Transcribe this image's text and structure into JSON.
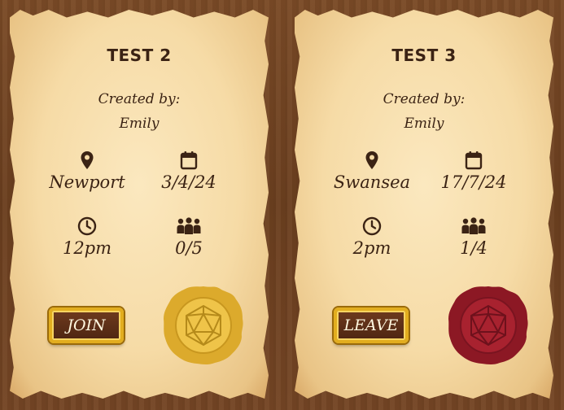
{
  "labels": {
    "created_by": "Created by:"
  },
  "cards": [
    {
      "title": "TEST 2",
      "creator": "Emily",
      "location": "Newport",
      "date": "3/4/24",
      "time": "12pm",
      "players": "0/5",
      "action_label": "JOIN",
      "seal_color": "#e9b83a",
      "seal_icon": "d20-icon"
    },
    {
      "title": "TEST 3",
      "creator": "Emily",
      "location": "Swansea",
      "date": "17/7/24",
      "time": "2pm",
      "players": "1/4",
      "action_label": "LEAVE",
      "seal_color": "#9e1f2a",
      "seal_icon": "d20-icon"
    }
  ],
  "colors": {
    "text": "#3b2314",
    "parchment": "#f6dba6",
    "wood": "#6b3f1f",
    "button_border": "#e2ad1f",
    "seal_gold": "#e9b83a",
    "seal_red": "#9e1f2a"
  }
}
